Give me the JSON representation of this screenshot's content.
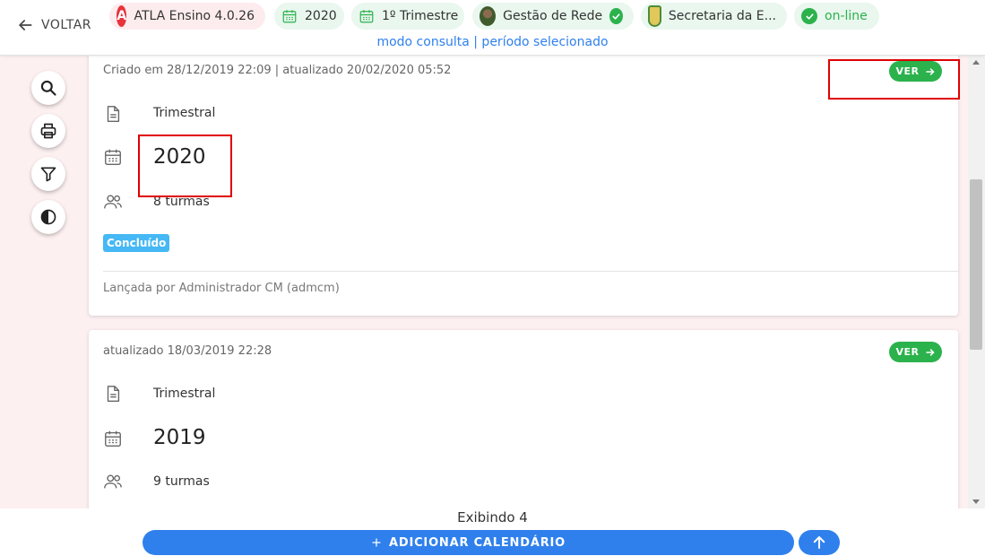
{
  "header": {
    "back_label": "VOLTAR",
    "chips": {
      "atla": "ATLA Ensino 4.0.26",
      "year": "2020",
      "trimestre": "1º Trimestre",
      "gestao": "Gestão de Rede",
      "secretaria": "Secretaria da E...",
      "online": "on-line"
    },
    "mode_text": "modo consulta | período selecionado"
  },
  "cards": [
    {
      "meta": "Criado em 28/12/2019 22:09 | atualizado 20/02/2020 05:52",
      "ver_label": "VER",
      "period": "Trimestral",
      "year": "2020",
      "turmas": "8 turmas",
      "status": "Concluído",
      "footer": "Lançada por Administrador CM (admcm)"
    },
    {
      "meta": "atualizado 18/03/2019 22:28",
      "ver_label": "VER",
      "period": "Trimestral",
      "year": "2019",
      "turmas": "9 turmas"
    }
  ],
  "bottom": {
    "count_label": "Exibindo 4",
    "add_label": "ADICIONAR CALENDÁRIO"
  },
  "colors": {
    "accent_blue": "#2f80ed",
    "success_green": "#2bb24c",
    "status_badge": "#45b8f5",
    "highlight_red": "#e00000"
  },
  "icons": [
    "arrow-left-icon",
    "atla-logo-icon",
    "calendar-icon",
    "user-avatar-icon",
    "check-icon",
    "crest-icon",
    "search-icon",
    "print-icon",
    "filter-icon",
    "contrast-icon",
    "arrow-right-icon",
    "document-icon",
    "people-icon",
    "plus-icon",
    "arrow-up-icon"
  ]
}
